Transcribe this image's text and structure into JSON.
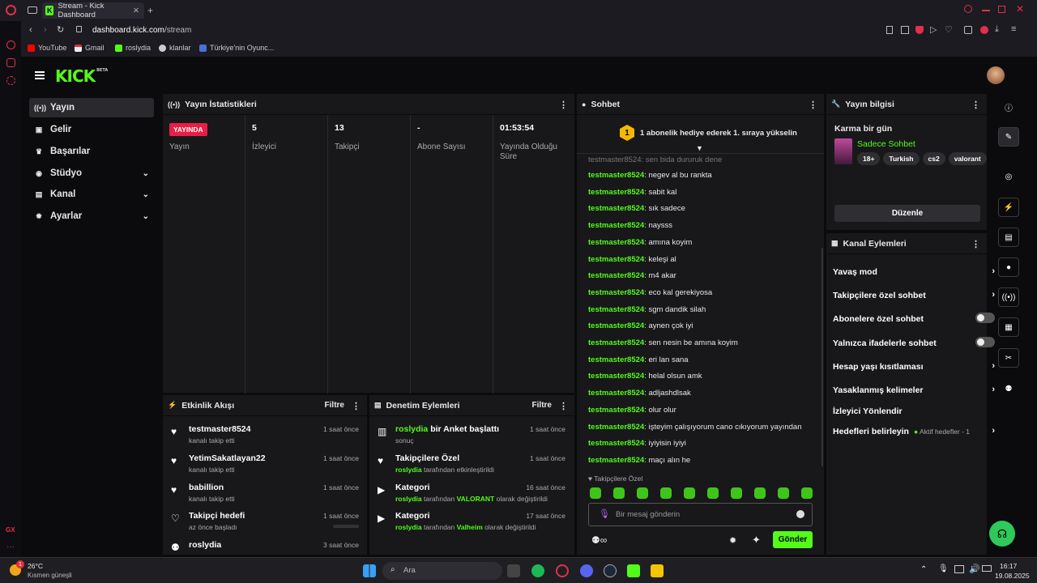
{
  "browser": {
    "tab_title": "Stream - Kick Dashboard",
    "new_tab": "+",
    "url_domain": "dashboard.kick.com",
    "url_path": "/stream",
    "bookmarks": [
      "YouTube",
      "Gmail",
      "roslydia",
      "klanlar",
      "Türkiye'nin Oyunc..."
    ]
  },
  "brand": {
    "logo": "KICK",
    "beta": "BETA",
    "accent": "#53fc18"
  },
  "nav": [
    {
      "label": "Yayın",
      "icon": "broadcast-icon"
    },
    {
      "label": "Gelir",
      "icon": "wallet-icon"
    },
    {
      "label": "Başarılar",
      "icon": "trophy-icon"
    },
    {
      "label": "Stüdyo",
      "icon": "studio-icon"
    },
    {
      "label": "Kanal",
      "icon": "channel-icon"
    },
    {
      "label": "Ayarlar",
      "icon": "gear-icon"
    }
  ],
  "stats": {
    "title": "Yayın İstatistikleri",
    "live_badge": "YAYINDA",
    "live_label": "Yayın",
    "viewers_value": "5",
    "viewers_label": "İzleyici",
    "followers_value": "13",
    "followers_label": "Takipçi",
    "subs_value": "-",
    "subs_label": "Abone Sayısı",
    "uptime_value": "01:53:54",
    "uptime_label": "Yayında Olduğu Süre"
  },
  "activity": {
    "title": "Etkinlik Akışı",
    "filter": "Filtre",
    "items": [
      {
        "name": "testmaster8524",
        "sub": "kanalı takip etti",
        "time": "1 saat önce"
      },
      {
        "name": "YetimSakatlayan22",
        "sub": "kanalı takip etti",
        "time": "1 saat önce"
      },
      {
        "name": "babillion",
        "sub": "kanalı takip etti",
        "time": "1 saat önce"
      },
      {
        "name": "Takipçi hedefi",
        "sub": "az önce başladı",
        "time": "1 saat önce"
      },
      {
        "name": "roslydia",
        "sub": "",
        "time": "3 saat önce"
      }
    ]
  },
  "moderation": {
    "title": "Denetim Eylemleri",
    "filter": "Filtre",
    "items": [
      {
        "user": "roslydia",
        "title": "bir Anket başlattı",
        "sub": "sonuç",
        "time": "1 saat önce"
      },
      {
        "title": "Takipçilere Özel",
        "user": "roslydia",
        "sub": "tarafından etkinleştirildi",
        "time": "1 saat önce"
      },
      {
        "title": "Kategori",
        "user": "roslydia",
        "mid": "tarafından",
        "game": "VALORANT",
        "sub": "olarak değiştirildi",
        "time": "16 saat önce"
      },
      {
        "title": "Kategori",
        "user": "roslydia",
        "mid": "tarafından",
        "game": "Valheim",
        "sub": "olarak değiştirildi",
        "time": "17 saat önce"
      }
    ]
  },
  "chat": {
    "title": "Sohbet",
    "banner_count": "1",
    "banner": "1 abonelik hediye ederek 1. sıraya yükselin",
    "partial_top": "testmaster8524: sen bida dururuk dene",
    "messages": [
      {
        "user": "testmaster8524",
        "text": "negev al bu rankta"
      },
      {
        "user": "testmaster8524",
        "text": "sabit kal"
      },
      {
        "user": "testmaster8524",
        "text": "sık sadece"
      },
      {
        "user": "testmaster8524",
        "text": "naysss"
      },
      {
        "user": "testmaster8524",
        "text": "amına koyim"
      },
      {
        "user": "testmaster8524",
        "text": "keleşi al"
      },
      {
        "user": "testmaster8524",
        "text": "m4 akar"
      },
      {
        "user": "testmaster8524",
        "text": "eco kal gerekiyosa"
      },
      {
        "user": "testmaster8524",
        "text": "sgm dandik silah"
      },
      {
        "user": "testmaster8524",
        "text": "aynen çok iyi"
      },
      {
        "user": "testmaster8524",
        "text": "sen nesin be amına koyim"
      },
      {
        "user": "testmaster8524",
        "text": "eri lan sana"
      },
      {
        "user": "testmaster8524",
        "text": "helal olsun amk"
      },
      {
        "user": "testmaster8524",
        "text": "adljashdlsak"
      },
      {
        "user": "testmaster8524",
        "text": "olur olur"
      },
      {
        "user": "testmaster8524",
        "text": "işteyim çalışıyorum cano cıkıyorum yayından"
      },
      {
        "user": "testmaster8524",
        "text": "iyiyisin iyiyi"
      },
      {
        "user": "testmaster8524",
        "text": "maçı alın he"
      }
    ],
    "followers_only": "Takipçilere Özel",
    "placeholder": "Bir mesaj gönderin",
    "send": "Gönder"
  },
  "info": {
    "title": "Yayın bilgisi",
    "stream_title": "Karma bir gün",
    "category": "Sadece Sohbet",
    "tags": [
      "18+",
      "Turkish",
      "cs2",
      "valorant"
    ],
    "edit": "Düzenle"
  },
  "channel_actions": {
    "title": "Kanal Eylemleri",
    "items": [
      {
        "label": "Yavaş mod",
        "kind": "arrow"
      },
      {
        "label": "Takipçilere özel sohbet",
        "kind": "arrow"
      },
      {
        "label": "Abonelere özel sohbet",
        "kind": "toggle"
      },
      {
        "label": "Yalnızca ifadelerle sohbet",
        "kind": "toggle"
      },
      {
        "label": "Hesap yaşı kısıtlaması",
        "kind": "arrow"
      },
      {
        "label": "Yasaklanmış kelimeler",
        "kind": "arrow"
      },
      {
        "label": "İzleyici Yönlendir",
        "kind": "none"
      },
      {
        "label": "Hedefleri belirleyin",
        "kind": "goal"
      }
    ],
    "goal_status": "Aktif hedefler - 1"
  },
  "taskbar": {
    "weather_temp": "26°C",
    "weather_desc": "Kısmen güneşli",
    "badge": "1",
    "search": "Ara",
    "time": "16:17",
    "date": "19.08.2025"
  }
}
